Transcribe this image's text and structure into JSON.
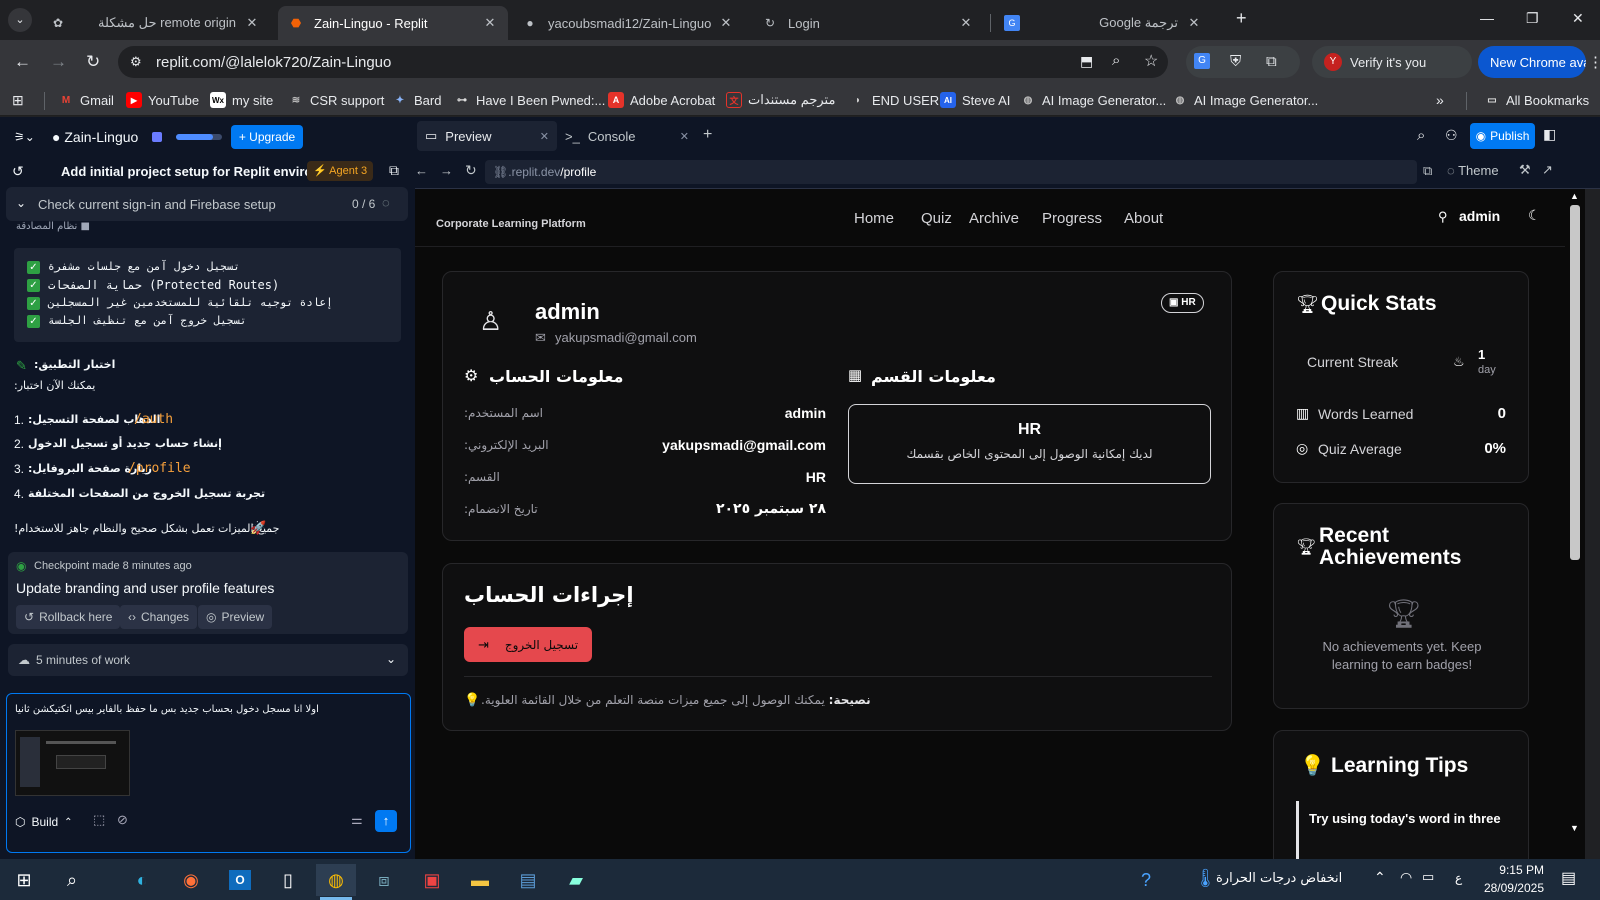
{
  "browser": {
    "tabs": [
      {
        "title": "حل مشكلة remote origin",
        "active": false
      },
      {
        "title": "Zain-Linguo - Replit",
        "active": true
      },
      {
        "title": "yacoubsmadi12/Zain-Linguo",
        "active": false
      },
      {
        "title": "Login",
        "active": false
      },
      {
        "title": "Google ترجمة",
        "active": false
      }
    ],
    "url": "replit.com/@lalelok720/Zain-Linguo",
    "verify_label": "Verify it's you",
    "verify_avatar": "Y",
    "new_chrome_label": "New Chrome available",
    "bookmarks": [
      {
        "label": "Gmail",
        "icon": "gmail-icon"
      },
      {
        "label": "YouTube",
        "icon": "youtube-icon"
      },
      {
        "label": "my site",
        "icon": "wix-icon"
      },
      {
        "label": "CSR support",
        "icon": "csr-icon"
      },
      {
        "label": "Bard",
        "icon": "bard-icon"
      },
      {
        "label": "Have I Been Pwned:...",
        "icon": "hibp-icon"
      },
      {
        "label": "Adobe Acrobat",
        "icon": "acrobat-icon"
      },
      {
        "label": "مترجم مستندات",
        "icon": "translator-icon"
      },
      {
        "label": "END USER",
        "icon": "enduser-icon"
      },
      {
        "label": "Steve AI",
        "icon": "steveai-icon"
      },
      {
        "label": "AI Image Generator...",
        "icon": "ai-image-icon"
      },
      {
        "label": "AI Image Generator...",
        "icon": "ai-image-icon-2"
      }
    ],
    "all_bookmarks": "All Bookmarks"
  },
  "replit": {
    "project": "Zain-Linguo",
    "upgrade": "Upgrade",
    "chat_title": "Add initial project setup for Replit enviro...",
    "agent_badge": "Agent 3",
    "task_title": "Check current sign-in and Firebase setup",
    "task_progress": "0 / 6",
    "partial_header": "نظام المصادقة",
    "checklist": [
      "تسجيل دخول آمن مع جلسات مشفرة",
      "حماية الصفحات (Protected Routes)",
      "إعادة توجيه تلقائية للمستخدمين غير المسجلين",
      "تسجيل خروج آمن مع تنظيف الجلسة"
    ],
    "test_heading": "اختبار التطبيق:",
    "test_sub": "يمكنك الآن اختبار:",
    "steps": [
      {
        "text": "الذهاب لصفحة التسجيل:",
        "code": "/auth"
      },
      {
        "text": "إنشاء حساب جديد أو تسجيل الدخول",
        "code": ""
      },
      {
        "text": "زيارة صفحة البروفايل:",
        "code": "/profile"
      },
      {
        "text": "تجربة تسجيل الخروج من الصفحات المختلفة",
        "code": ""
      }
    ],
    "final_line": "جميع الميزات تعمل بشكل صحيح والنظام جاهز للاستخدام!",
    "checkpoint_time": "Checkpoint made 8 minutes ago",
    "checkpoint_title": "Update branding and user profile features",
    "rollback": "Rollback here",
    "changes": "Changes",
    "preview_btn": "Preview",
    "work_time": "5 minutes of work",
    "input_text": "اولا انا مسجل دخول بحساب جديد بس ما حفظ بالفاير بيس اتكتيكشن ثانيا",
    "build_label": "Build",
    "pane_tabs": [
      "Preview",
      "Console"
    ],
    "publish": "Publish",
    "preview_url_pre": ".replit.dev",
    "preview_url_path": "/profile",
    "theme": "Theme"
  },
  "site": {
    "brand": "Corporate Learning Platform",
    "nav": [
      "Home",
      "Quiz",
      "Archive",
      "Progress",
      "About"
    ],
    "user": "admin",
    "profile": {
      "name": "admin",
      "email": "yakupsmadi@gmail.com",
      "badge": "HR",
      "account_heading": "معلومات الحساب",
      "fields": [
        {
          "label": "اسم المستخدم:",
          "value": "admin"
        },
        {
          "label": "البريد الإلكتروني:",
          "value": "yakupsmadi@gmail.com"
        },
        {
          "label": "القسم:",
          "value": "HR"
        },
        {
          "label": "تاريخ الانضمام:",
          "value": "٢٨ سبتمبر ٢٠٢٥"
        }
      ],
      "dept_heading": "معلومات القسم",
      "dept_name": "HR",
      "dept_desc": "لديك إمكانية الوصول إلى المحتوى الخاص بقسمك"
    },
    "actions": {
      "heading": "إجراءات الحساب",
      "logout": "تسجيل الخروج",
      "tip_label": "نصيحة:",
      "tip_text": "يمكنك الوصول إلى جميع ميزات منصة التعلم من خلال القائمة العلوية."
    },
    "quick_stats": {
      "heading": "Quick Stats",
      "streak_label": "Current Streak",
      "streak_value": "1",
      "streak_unit": "day",
      "words_label": "Words Learned",
      "words_value": "0",
      "quiz_label": "Quiz Average",
      "quiz_value": "0%"
    },
    "achievements": {
      "heading_1": "Recent",
      "heading_2": "Achievements",
      "empty": "No achievements yet. Keep learning to earn badges!"
    },
    "tips": {
      "heading": "Learning Tips",
      "first": "Try using today's word in three"
    }
  },
  "taskbar": {
    "weather": "انخفاض درجات الحرارة",
    "lang": "ع",
    "time": "9:15 PM",
    "date": "28/09/2025"
  }
}
